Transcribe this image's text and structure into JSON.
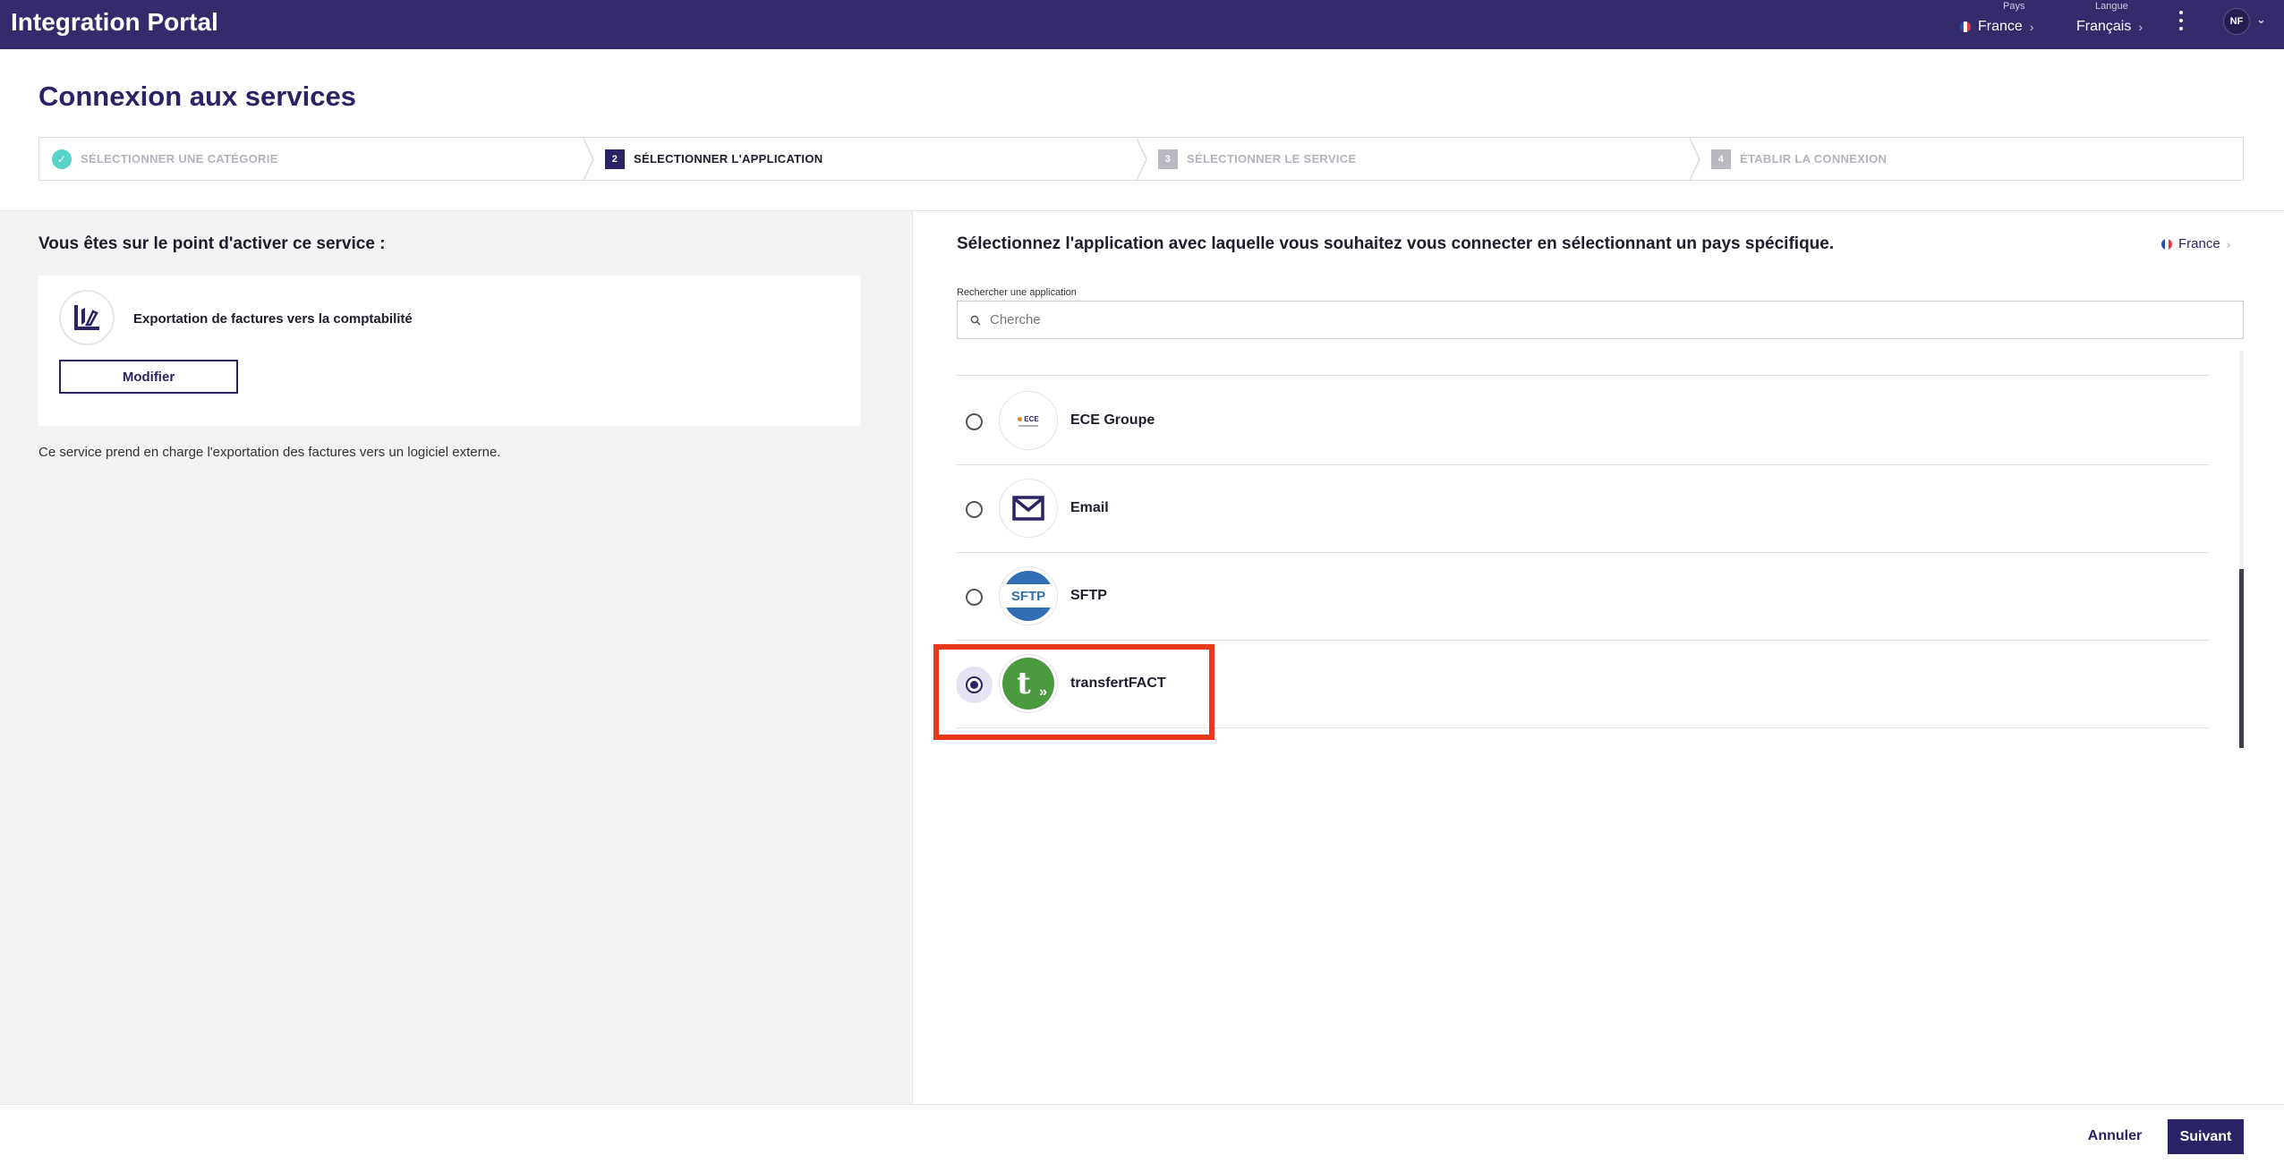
{
  "app": {
    "title": "Integration Portal"
  },
  "header": {
    "country_label": "Pays",
    "country_value": "France",
    "language_label": "Langue",
    "language_value": "Français",
    "user_initials": "NF"
  },
  "page": {
    "title": "Connexion aux services"
  },
  "stepper": {
    "steps": [
      {
        "number": "",
        "label": "SÉLECTIONNER UNE CATÉGORIE",
        "state": "done"
      },
      {
        "number": "2",
        "label": "SÉLECTIONNER L'APPLICATION",
        "state": "active"
      },
      {
        "number": "3",
        "label": "SÉLECTIONNER LE SERVICE",
        "state": "pending"
      },
      {
        "number": "4",
        "label": "ÉTABLIR LA CONNEXION",
        "state": "pending"
      }
    ]
  },
  "left": {
    "heading": "Vous êtes sur le point d'activer ce service :",
    "service_name": "Exportation de factures vers la comptabilité",
    "modify_label": "Modifier",
    "description": "Ce service prend en charge l'exportation des factures vers un logiciel externe."
  },
  "right": {
    "heading": "Sélectionnez l'application avec laquelle vous souhaitez vous connecter en sélectionnant un pays spécifique.",
    "country": "France",
    "search_label": "Rechercher une application",
    "search_placeholder": "Cherche",
    "apps": [
      {
        "name": "ECE Groupe",
        "logo_text": "ECE",
        "selected": false
      },
      {
        "name": "Email",
        "logo_text": "",
        "selected": false
      },
      {
        "name": "SFTP",
        "logo_text": "SFTP",
        "selected": false
      },
      {
        "name": "transfertFACT",
        "logo_text": "t",
        "selected": true
      }
    ]
  },
  "footer": {
    "cancel_label": "Annuler",
    "next_label": "Suivant"
  },
  "colors": {
    "brand": "#332b6b",
    "accent": "#2a2366",
    "step_done": "#57d3c7",
    "highlight": "#e8391c",
    "sftp": "#2f6db5",
    "transfertfact": "#4c9a3f"
  }
}
